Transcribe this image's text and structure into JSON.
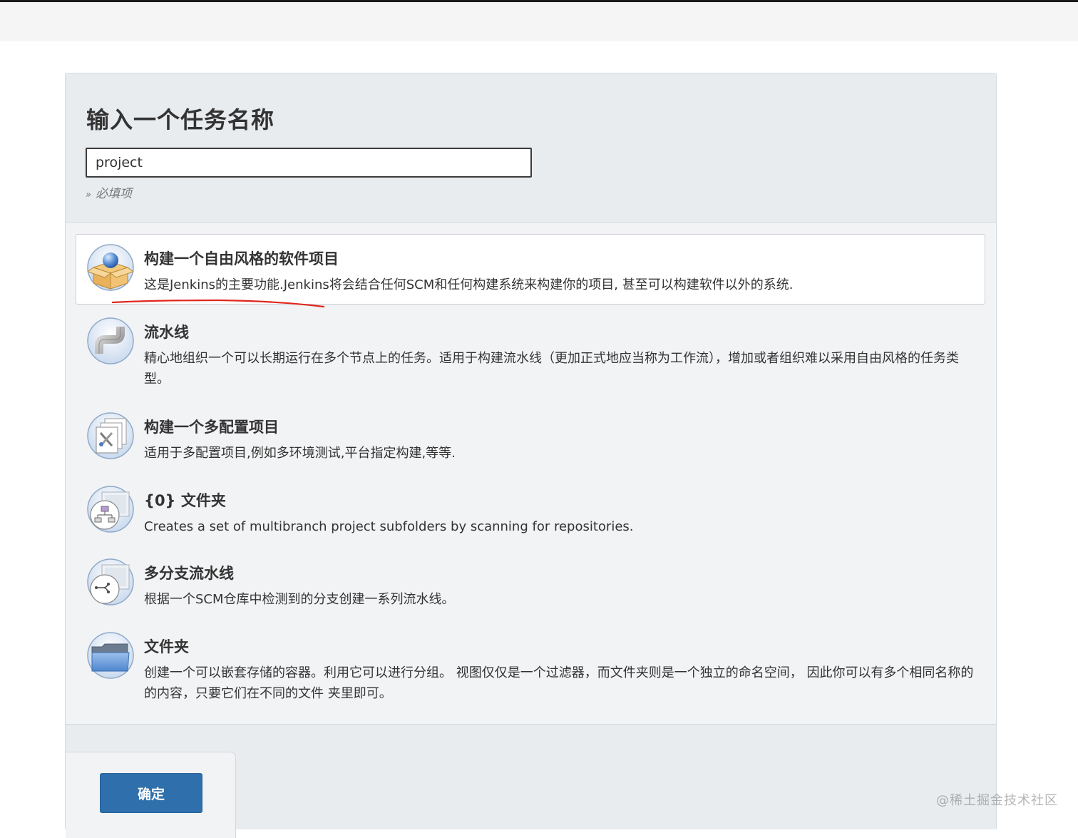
{
  "header": {
    "title": "输入一个任务名称",
    "input_value": "project",
    "required_marker": "»",
    "required_text": "必填项"
  },
  "items": [
    {
      "title": "构建一个自由风格的软件项目",
      "description": "这是Jenkins的主要功能.Jenkins将会结合任何SCM和任何构建系统来构建你的项目, 甚至可以构建软件以外的系统.",
      "icon": "freestyle-box-icon",
      "selected": true
    },
    {
      "title": "流水线",
      "description": "精心地组织一个可以长期运行在多个节点上的任务。适用于构建流水线（更加正式地应当称为工作流），增加或者组织难以采用自由风格的任务类型。",
      "icon": "pipeline-icon",
      "selected": false
    },
    {
      "title": "构建一个多配置项目",
      "description": "适用于多配置项目,例如多环境测试,平台指定构建,等等.",
      "icon": "multi-config-icon",
      "selected": false
    },
    {
      "title": "{0} 文件夹",
      "description": "Creates a set of multibranch project subfolders by scanning for repositories.",
      "icon": "organization-folder-icon",
      "selected": false
    },
    {
      "title": "多分支流水线",
      "description": "根据一个SCM仓库中检测到的分支创建一系列流水线。",
      "icon": "multibranch-pipeline-icon",
      "selected": false
    },
    {
      "title": "文件夹",
      "description": "创建一个可以嵌套存储的容器。利用它可以进行分组。 视图仅仅是一个过滤器，而文件夹则是一个独立的命名空间， 因此你可以有多个相同名称的的内容，只要它们在不同的文件 夹里即可。",
      "icon": "folder-icon",
      "selected": false
    }
  ],
  "footer": {
    "ok_label": "确定"
  },
  "watermark": "@稀土掘金技术社区",
  "colors": {
    "accent_button": "#2f6fab",
    "annotation_underline": "#e0261d",
    "panel_background": "#f2f3f5",
    "selected_item_background": "#ffffff"
  }
}
